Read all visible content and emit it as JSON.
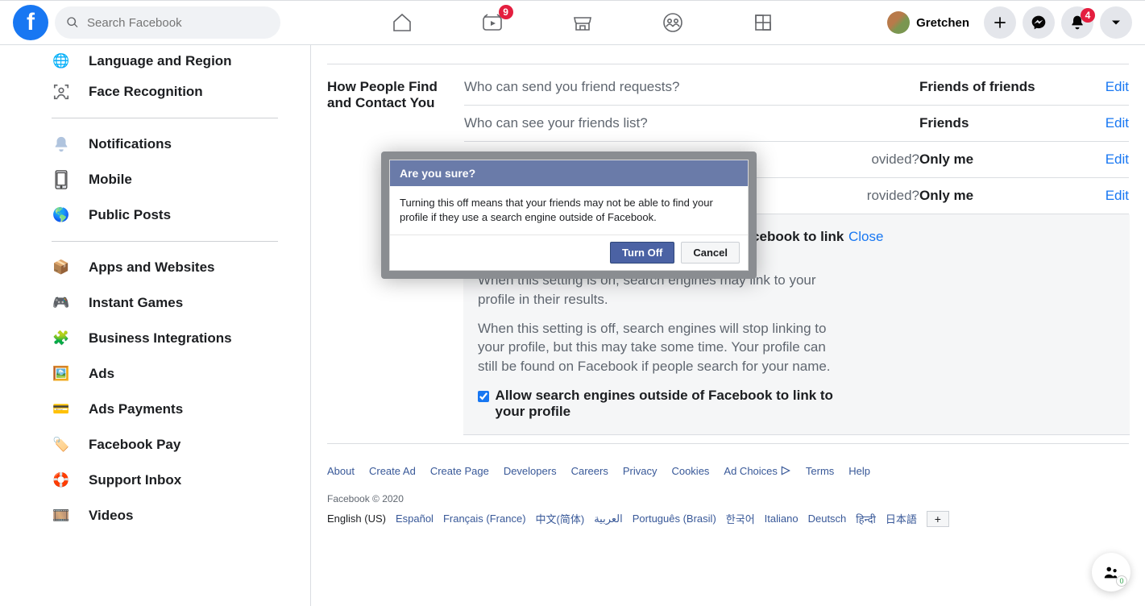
{
  "header": {
    "search_placeholder": "Search Facebook",
    "watch_badge": "9",
    "user_name": "Gretchen",
    "notif_badge": "4"
  },
  "sidebar": {
    "clipped_label": "Language and Region",
    "items": [
      {
        "label": "Face Recognition"
      },
      {
        "label": "Notifications"
      },
      {
        "label": "Mobile"
      },
      {
        "label": "Public Posts"
      },
      {
        "label": "Apps and Websites"
      },
      {
        "label": "Instant Games"
      },
      {
        "label": "Business Integrations"
      },
      {
        "label": "Ads"
      },
      {
        "label": "Ads Payments"
      },
      {
        "label": "Facebook Pay"
      },
      {
        "label": "Support Inbox"
      },
      {
        "label": "Videos"
      }
    ]
  },
  "section": {
    "title": "How People Find and Contact You",
    "rows": [
      {
        "label": "Who can send you friend requests?",
        "value": "Friends of friends",
        "action": "Edit"
      },
      {
        "label": "Who can see your friends list?",
        "value": "Friends",
        "action": "Edit"
      },
      {
        "label": "ovided?",
        "value": "Only me",
        "action": "Edit"
      },
      {
        "label": "rovided?",
        "value": "Only me",
        "action": "Edit"
      }
    ],
    "expanded": {
      "title": "Do you want search engines outside of Facebook to link to your profile?",
      "close": "Close",
      "desc1": "When this setting is on, search engines may link to your profile in their results.",
      "desc2": "When this setting is off, search engines will stop linking to your profile, but this may take some time. Your profile can still be found on Facebook if people search for your name.",
      "checkbox_label": "Allow search engines outside of Facebook to link to your profile"
    }
  },
  "modal": {
    "title": "Are you sure?",
    "body": "Turning this off means that your friends may not be able to find your profile if they use a search engine outside of Facebook.",
    "turn_off": "Turn Off",
    "cancel": "Cancel"
  },
  "footer": {
    "links": [
      "About",
      "Create Ad",
      "Create Page",
      "Developers",
      "Careers",
      "Privacy",
      "Cookies",
      "Ad Choices",
      "Terms",
      "Help"
    ],
    "copyright": "Facebook © 2020",
    "current_lang": "English (US)",
    "langs": [
      "Español",
      "Français (France)",
      "中文(简体)",
      "العربية",
      "Português (Brasil)",
      "한국어",
      "Italiano",
      "Deutsch",
      "हिन्दी",
      "日本語"
    ]
  },
  "float": {
    "count": "0"
  }
}
